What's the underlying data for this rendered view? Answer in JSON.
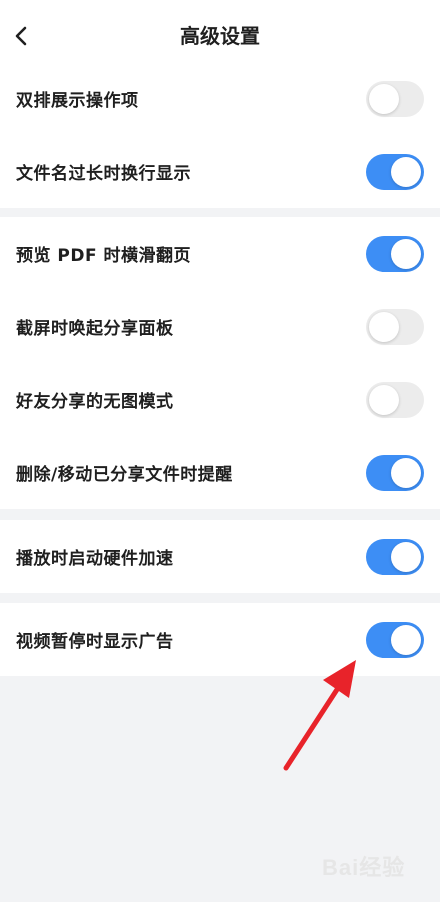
{
  "header": {
    "title": "高级设置",
    "back_icon": "chevron-left-icon"
  },
  "sections": [
    {
      "items": [
        {
          "label": "双排展示操作项",
          "on": false
        },
        {
          "label": "文件名过长时换行显示",
          "on": true
        }
      ]
    },
    {
      "items": [
        {
          "label": "预览 PDF 时横滑翻页",
          "on": true
        },
        {
          "label": "截屏时唤起分享面板",
          "on": false
        },
        {
          "label": "好友分享的无图模式",
          "on": false
        },
        {
          "label": "删除/移动已分享文件时提醒",
          "on": true
        }
      ]
    },
    {
      "items": [
        {
          "label": "播放时启动硬件加速",
          "on": true
        }
      ]
    },
    {
      "items": [
        {
          "label": "视频暂停时显示广告",
          "on": true
        }
      ]
    }
  ],
  "annotation": {
    "icon": "red-arrow-icon",
    "color": "#e8232a"
  },
  "watermark": {
    "text": "Bai经验"
  },
  "colors": {
    "toggle_on": "#3d8ef5",
    "toggle_off": "#ececec",
    "background": "#f2f3f5"
  }
}
